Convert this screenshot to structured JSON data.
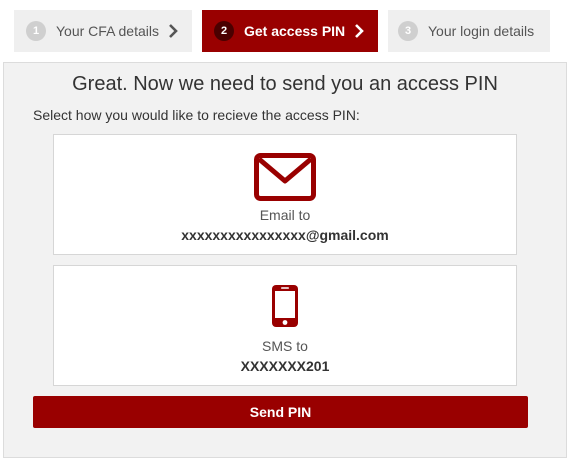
{
  "steps": [
    {
      "number": "1",
      "label": "Your CFA details",
      "state": "inactive"
    },
    {
      "number": "2",
      "label": "Get access PIN",
      "state": "active"
    },
    {
      "number": "3",
      "label": "Your login details",
      "state": "inactive"
    }
  ],
  "panel": {
    "title": "Great. Now we need to send you an access PIN",
    "subtitle": "Select how you would like to recieve the access PIN:"
  },
  "options": {
    "email": {
      "icon": "envelope-icon",
      "label": "Email to",
      "value": "xxxxxxxxxxxxxxxx@gmail.com"
    },
    "sms": {
      "icon": "mobile-phone-icon",
      "label": "SMS to",
      "value": "XXXXXXX201"
    }
  },
  "send_button": {
    "label": "Send PIN"
  },
  "colors": {
    "accent": "#990000",
    "step_inactive_bg": "#efefef",
    "panel_bg": "#f2f2f2"
  }
}
